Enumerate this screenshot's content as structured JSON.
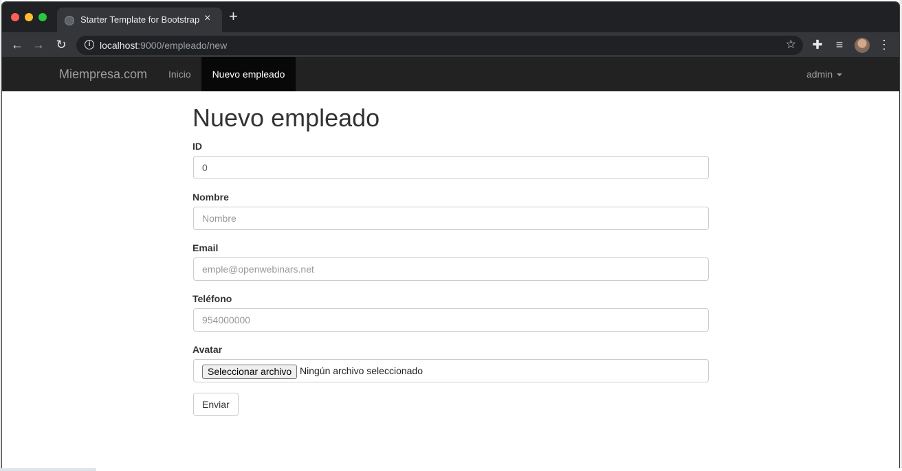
{
  "browser": {
    "tab_title": "Starter Template for Bootstrap",
    "tab_close": "×",
    "new_tab": "+",
    "url_host": "localhost",
    "url_path": ":9000/empleado/new"
  },
  "navbar": {
    "brand": "Miempresa.com",
    "items": [
      {
        "label": "Inicio",
        "active": false
      },
      {
        "label": "Nuevo empleado",
        "active": true
      }
    ],
    "user": "admin"
  },
  "page": {
    "title": "Nuevo empleado"
  },
  "form": {
    "id": {
      "label": "ID",
      "value": "0"
    },
    "nombre": {
      "label": "Nombre",
      "placeholder": "Nombre",
      "value": ""
    },
    "email": {
      "label": "Email",
      "placeholder": "emple@openwebinars.net",
      "value": ""
    },
    "telefono": {
      "label": "Teléfono",
      "placeholder": "954000000",
      "value": ""
    },
    "avatar": {
      "label": "Avatar",
      "button_label": "Seleccionar archivo",
      "status": "Ningún archivo seleccionado"
    },
    "submit_label": "Enviar"
  },
  "colors": {
    "navbar_bg": "#222222",
    "navbar_active_bg": "#080808",
    "browser_tabstrip": "#202124",
    "browser_toolbar": "#35363a"
  }
}
